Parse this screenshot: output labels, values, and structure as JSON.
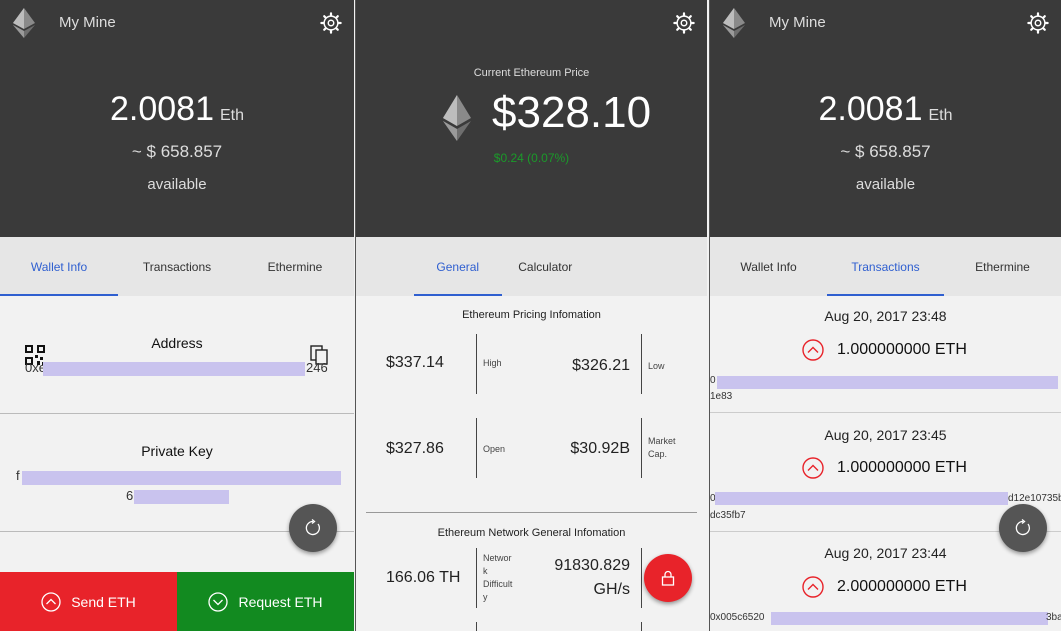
{
  "colors": {
    "header_bg": "#3a3a3a",
    "accent": "#2f5fd0",
    "send": "#e8232a",
    "request": "#128a20",
    "price_up": "#1b9a2a"
  },
  "wallet": {
    "app_title": "My Mine",
    "balance_value": "2.0081",
    "balance_unit": "Eth",
    "usd_approx": "~ $ 658.857",
    "available_label": "available"
  },
  "wallet_tabs": [
    "Wallet Info",
    "Transactions",
    "Ethermine"
  ],
  "wallet_info": {
    "address_title": "Address",
    "address_prefix": "0xe",
    "address_suffix": "246",
    "private_key_title": "Private Key",
    "private_key_prefix": "f",
    "private_key_line2_prefix": "6",
    "send_label": "Send ETH",
    "request_label": "Request ETH"
  },
  "price": {
    "label": "Current Ethereum Price",
    "value": "$328.10",
    "change": "$0.24 (0.07%)"
  },
  "price_tabs": [
    "General",
    "Calculator"
  ],
  "pricing_info": {
    "title": "Ethereum Pricing Infomation",
    "high_value": "$337.14",
    "high_label": "High",
    "low_value": "$326.21",
    "low_label": "Low",
    "open_value": "$327.86",
    "open_label": "Open",
    "cap_value": "$30.92B",
    "cap_label_1": "Market",
    "cap_label_2": "Cap."
  },
  "network_info": {
    "title": "Ethereum Network General Infomation",
    "difficulty_value": "166.06 TH",
    "difficulty_label_1": "Networ",
    "difficulty_label_2": "k",
    "difficulty_label_3": "Difficult",
    "difficulty_label_4": "y",
    "hashrate_value": "91830.829",
    "hashrate_unit": "GH/s"
  },
  "transactions": [
    {
      "date": "Aug 20, 2017 23:48",
      "amount": "1.000000000 ETH",
      "hash_prefix": "0",
      "hash_tail": "1e83"
    },
    {
      "date": "Aug 20, 2017 23:45",
      "amount": "1.000000000 ETH",
      "hash_prefix": "0",
      "hash_suffix": "d12e10735b",
      "hash_tail": "dc35fb7"
    },
    {
      "date": "Aug 20, 2017 23:44",
      "amount": "2.000000000 ETH",
      "hash_prefix": "0x005c6520",
      "hash_suffix": "3ba"
    }
  ]
}
